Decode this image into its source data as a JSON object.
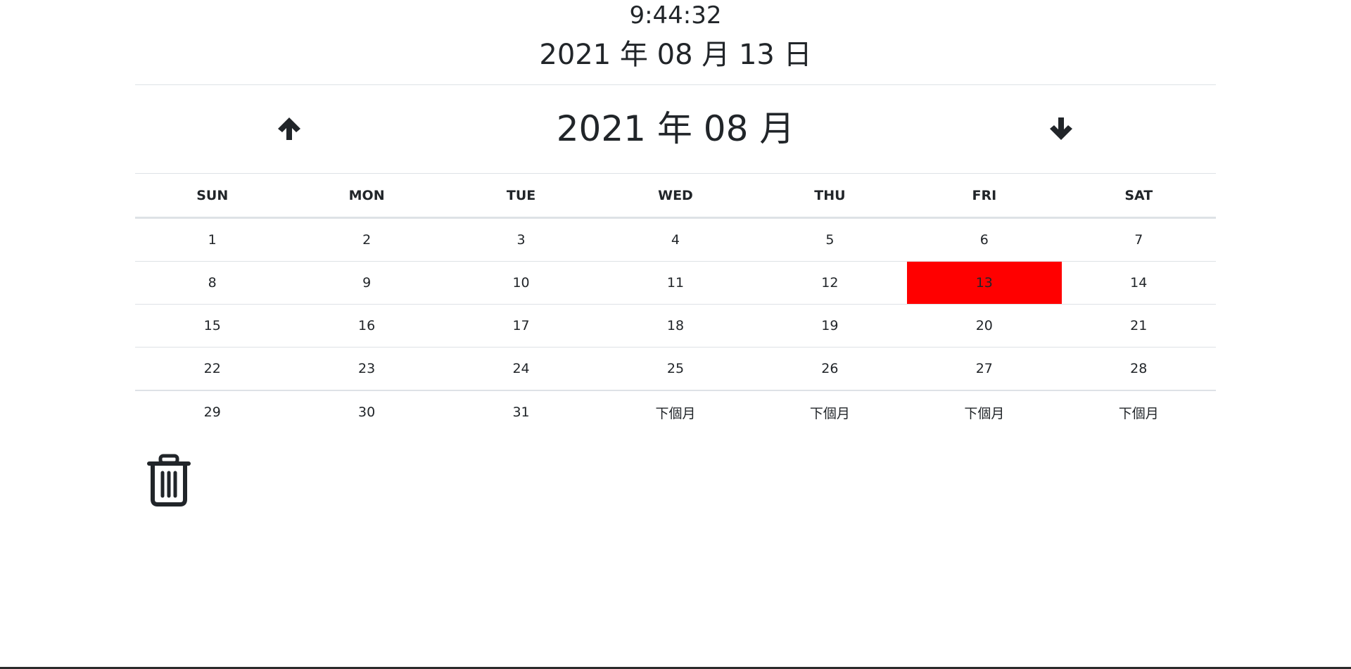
{
  "clock": {
    "time": "9:44:32",
    "date": "2021 年 08 月 13 日"
  },
  "calendar": {
    "month_title": "2021 年 08 月",
    "prev_icon": "arrow-up-icon",
    "next_icon": "arrow-down-icon",
    "weekdays": [
      "SUN",
      "MON",
      "TUE",
      "WED",
      "THU",
      "FRI",
      "SAT"
    ],
    "weeks": [
      [
        "1",
        "2",
        "3",
        "4",
        "5",
        "6",
        "7"
      ],
      [
        "8",
        "9",
        "10",
        "11",
        "12",
        "13",
        "14"
      ],
      [
        "15",
        "16",
        "17",
        "18",
        "19",
        "20",
        "21"
      ],
      [
        "22",
        "23",
        "24",
        "25",
        "26",
        "27",
        "28"
      ],
      [
        "29",
        "30",
        "31",
        "下個月",
        "下個月",
        "下個月",
        "下個月"
      ]
    ],
    "today": "13",
    "today_color": "#ff0000"
  },
  "actions": {
    "trash_icon": "trash-icon"
  }
}
